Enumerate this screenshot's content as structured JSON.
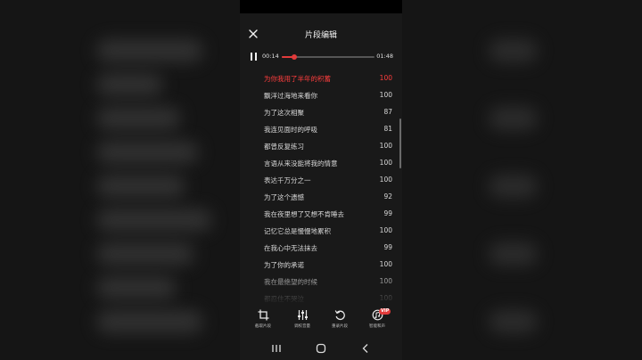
{
  "header": {
    "title": "片段编辑"
  },
  "player": {
    "current_time": "00:14",
    "total_time": "01:48",
    "progress": 0.13
  },
  "lyrics": [
    {
      "text": "为你我用了半年的积蓄",
      "score": "100",
      "active": true
    },
    {
      "text": "飘洋过海地来看你",
      "score": "100"
    },
    {
      "text": "为了这次相聚",
      "score": "87"
    },
    {
      "text": "我连见面时的呼吸",
      "score": "81"
    },
    {
      "text": "都曾反复练习",
      "score": "100"
    },
    {
      "text": "言语从来没能将我的情意",
      "score": "100"
    },
    {
      "text": "表达千万分之一",
      "score": "100"
    },
    {
      "text": "为了这个遗憾",
      "score": "92"
    },
    {
      "text": "我在夜里想了又想不肯睡去",
      "score": "99"
    },
    {
      "text": "记忆它总是慢慢地累积",
      "score": "100"
    },
    {
      "text": "在我心中无法抹去",
      "score": "99"
    },
    {
      "text": "为了你的承诺",
      "score": "100"
    },
    {
      "text": "我在最绝望的时候",
      "score": "100"
    },
    {
      "text": "都忍住不哭泣",
      "score": "100"
    }
  ],
  "toolbar": {
    "crop_label": "截取片段",
    "mix_label": "调校音量",
    "rerecord_label": "重录片段",
    "smart_label": "智能和声",
    "vip_badge": "VIP"
  },
  "colors": {
    "accent": "#e23b3b",
    "active_lyric": "#ff3d3d",
    "background": "#191919"
  }
}
